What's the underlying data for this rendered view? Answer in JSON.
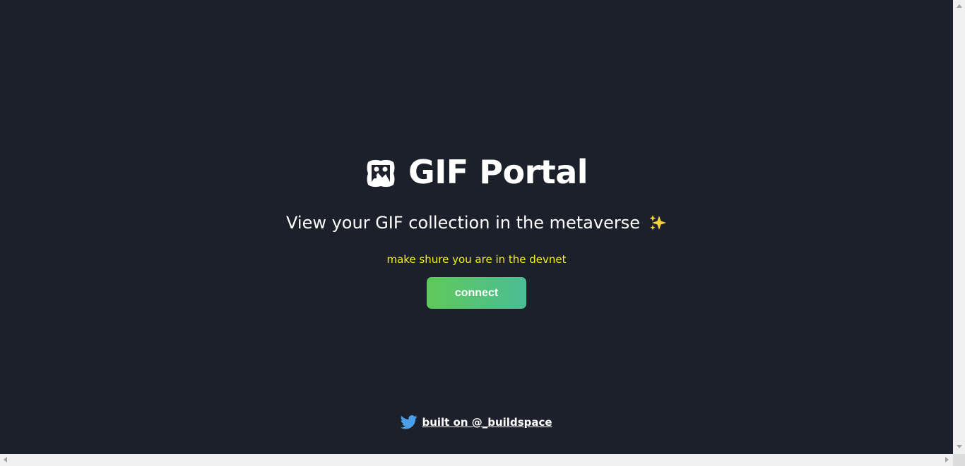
{
  "header": {
    "title": "GIF Portal",
    "title_icon": "framed-picture-icon",
    "subtitle": "View your GIF collection in the metaverse",
    "subtitle_icon": "sparkles-icon"
  },
  "notice": {
    "text": "make shure you are in the devnet",
    "color": "#f5f50f"
  },
  "connect": {
    "label": "connect",
    "gradient_start": "#5fc95a",
    "gradient_end": "#4bbd95"
  },
  "footer": {
    "icon": "twitter-icon",
    "link_text": "built on @_buildspace"
  },
  "theme": {
    "background": "#1b202b",
    "text": "#ffffff",
    "twitter_blue": "#1da1f2"
  }
}
